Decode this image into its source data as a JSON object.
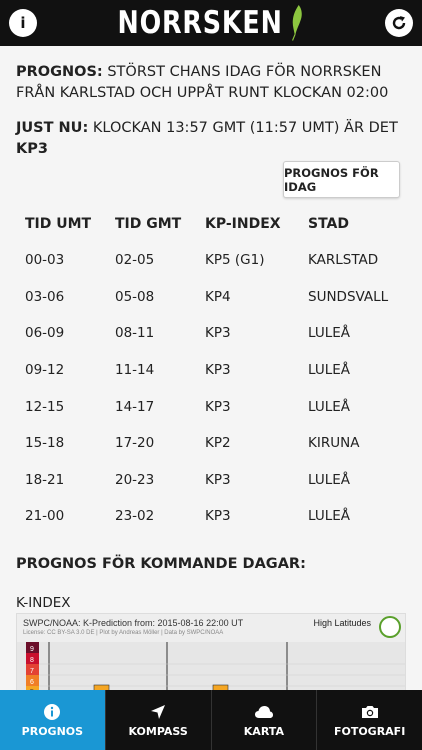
{
  "header": {
    "title": "NORRSKEN",
    "left_icon": "info-icon",
    "right_icon": "refresh-icon"
  },
  "prognos": {
    "label": "PROGNOS:",
    "text": "STÖRST CHANS IDAG FÖR NORRSKEN FRÅN KARLSTAD OCH UPPÅT RUNT KLOCKAN 02:00"
  },
  "just_nu": {
    "label": "JUST NU:",
    "text": "KLOCKAN 13:57 GMT (11:57 UMT) ÄR DET",
    "kp": "KP3"
  },
  "today_button": "PROGNOS FÖR IDAG",
  "table": {
    "headers": [
      "TID UMT",
      "TID GMT",
      "KP-INDEX",
      "STAD"
    ],
    "rows": [
      [
        "00-03",
        "02-05",
        "KP5 (G1)",
        "KARLSTAD"
      ],
      [
        "03-06",
        "05-08",
        "KP4",
        "SUNDSVALL"
      ],
      [
        "06-09",
        "08-11",
        "KP3",
        "LULEÅ"
      ],
      [
        "09-12",
        "11-14",
        "KP3",
        "LULEÅ"
      ],
      [
        "12-15",
        "14-17",
        "KP3",
        "LULEÅ"
      ],
      [
        "15-18",
        "17-20",
        "KP2",
        "KIRUNA"
      ],
      [
        "18-21",
        "20-23",
        "KP3",
        "LULEÅ"
      ],
      [
        "21-00",
        "23-02",
        "KP3",
        "LULEÅ"
      ]
    ]
  },
  "kommande": "PROGNOS FÖR KOMMANDE DAGAR:",
  "kindex_label": "K-INDEX",
  "kchart": {
    "title": "SWPC/NOAA: K-Prediction from: 2015-08-16 22:00 UT",
    "subtitle": "License: CC BY-SA 3.0 DE | Plot by Andreas Möller | Data by SWPC/NOAA",
    "latitude": "High Latitudes",
    "scale": [
      "9",
      "8",
      "7",
      "6",
      "5"
    ]
  },
  "tabs": [
    {
      "label": "PROGNOS",
      "icon": "info-icon",
      "active": true
    },
    {
      "label": "KOMPASS",
      "icon": "navigation-arrow-icon",
      "active": false
    },
    {
      "label": "KARTA",
      "icon": "cloud-icon",
      "active": false
    },
    {
      "label": "FOTOGRAFI",
      "icon": "camera-icon",
      "active": false
    }
  ],
  "colors": {
    "header_bg": "#111111",
    "tab_active": "#1a97d4",
    "leaf_green": "#8cc63f",
    "kp_bar": "#f5a623"
  }
}
